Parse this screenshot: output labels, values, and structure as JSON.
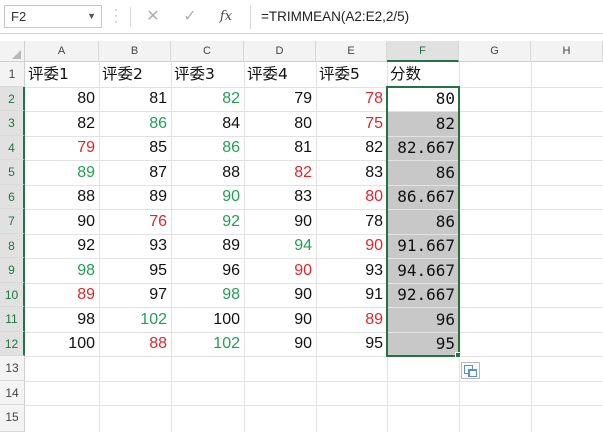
{
  "formula_bar": {
    "name_box": "F2",
    "cancel_icon": "✕",
    "enter_icon": "✓",
    "fx_label": "fx",
    "formula": "=TRIMMEAN(A2:E2,2/5)"
  },
  "columns": [
    "A",
    "B",
    "C",
    "D",
    "E",
    "F",
    "G",
    "H"
  ],
  "rows": [
    "1",
    "2",
    "3",
    "4",
    "5",
    "6",
    "7",
    "8",
    "9",
    "10",
    "11",
    "12",
    "13",
    "14",
    "15"
  ],
  "headers": [
    "评委1",
    "评委2",
    "评委3",
    "评委4",
    "评委5",
    "分数"
  ],
  "cells": [
    [
      {
        "v": "80",
        "c": ""
      },
      {
        "v": "81",
        "c": ""
      },
      {
        "v": "82",
        "c": "green"
      },
      {
        "v": "79",
        "c": ""
      },
      {
        "v": "78",
        "c": "red"
      },
      {
        "v": "80",
        "c": ""
      }
    ],
    [
      {
        "v": "82",
        "c": ""
      },
      {
        "v": "86",
        "c": "green"
      },
      {
        "v": "84",
        "c": ""
      },
      {
        "v": "80",
        "c": ""
      },
      {
        "v": "75",
        "c": "red"
      },
      {
        "v": "82",
        "c": ""
      }
    ],
    [
      {
        "v": "79",
        "c": "red"
      },
      {
        "v": "85",
        "c": ""
      },
      {
        "v": "86",
        "c": "green"
      },
      {
        "v": "81",
        "c": ""
      },
      {
        "v": "82",
        "c": ""
      },
      {
        "v": "82.667",
        "c": ""
      }
    ],
    [
      {
        "v": "89",
        "c": "green"
      },
      {
        "v": "87",
        "c": ""
      },
      {
        "v": "88",
        "c": ""
      },
      {
        "v": "82",
        "c": "red"
      },
      {
        "v": "83",
        "c": ""
      },
      {
        "v": "86",
        "c": ""
      }
    ],
    [
      {
        "v": "88",
        "c": ""
      },
      {
        "v": "89",
        "c": ""
      },
      {
        "v": "90",
        "c": "green"
      },
      {
        "v": "83",
        "c": ""
      },
      {
        "v": "80",
        "c": "red"
      },
      {
        "v": "86.667",
        "c": ""
      }
    ],
    [
      {
        "v": "90",
        "c": ""
      },
      {
        "v": "76",
        "c": "red"
      },
      {
        "v": "92",
        "c": "green"
      },
      {
        "v": "90",
        "c": ""
      },
      {
        "v": "78",
        "c": ""
      },
      {
        "v": "86",
        "c": ""
      }
    ],
    [
      {
        "v": "92",
        "c": ""
      },
      {
        "v": "93",
        "c": ""
      },
      {
        "v": "89",
        "c": ""
      },
      {
        "v": "94",
        "c": "green"
      },
      {
        "v": "90",
        "c": "red"
      },
      {
        "v": "91.667",
        "c": ""
      }
    ],
    [
      {
        "v": "98",
        "c": "green"
      },
      {
        "v": "95",
        "c": ""
      },
      {
        "v": "96",
        "c": ""
      },
      {
        "v": "90",
        "c": "red"
      },
      {
        "v": "93",
        "c": ""
      },
      {
        "v": "94.667",
        "c": ""
      }
    ],
    [
      {
        "v": "89",
        "c": "red"
      },
      {
        "v": "97",
        "c": ""
      },
      {
        "v": "98",
        "c": "green"
      },
      {
        "v": "90",
        "c": ""
      },
      {
        "v": "91",
        "c": ""
      },
      {
        "v": "92.667",
        "c": ""
      }
    ],
    [
      {
        "v": "98",
        "c": ""
      },
      {
        "v": "102",
        "c": "green"
      },
      {
        "v": "100",
        "c": ""
      },
      {
        "v": "90",
        "c": ""
      },
      {
        "v": "89",
        "c": "red"
      },
      {
        "v": "96",
        "c": ""
      }
    ],
    [
      {
        "v": "100",
        "c": ""
      },
      {
        "v": "88",
        "c": "red"
      },
      {
        "v": "102",
        "c": "green"
      },
      {
        "v": "90",
        "c": ""
      },
      {
        "v": "95",
        "c": ""
      },
      {
        "v": "95",
        "c": ""
      }
    ]
  ],
  "colors": {
    "red": "#e0262b",
    "green": "#21a055",
    "selection_border": "#217346",
    "selection_fill": "#c8c8c8"
  },
  "icons": {
    "name_box_dropdown": "chevron-down-icon",
    "cancel": "close-icon",
    "enter": "check-icon",
    "function": "fx-icon",
    "quick_analysis": "quick-analysis-icon",
    "select_all": "select-all-triangle-icon"
  }
}
